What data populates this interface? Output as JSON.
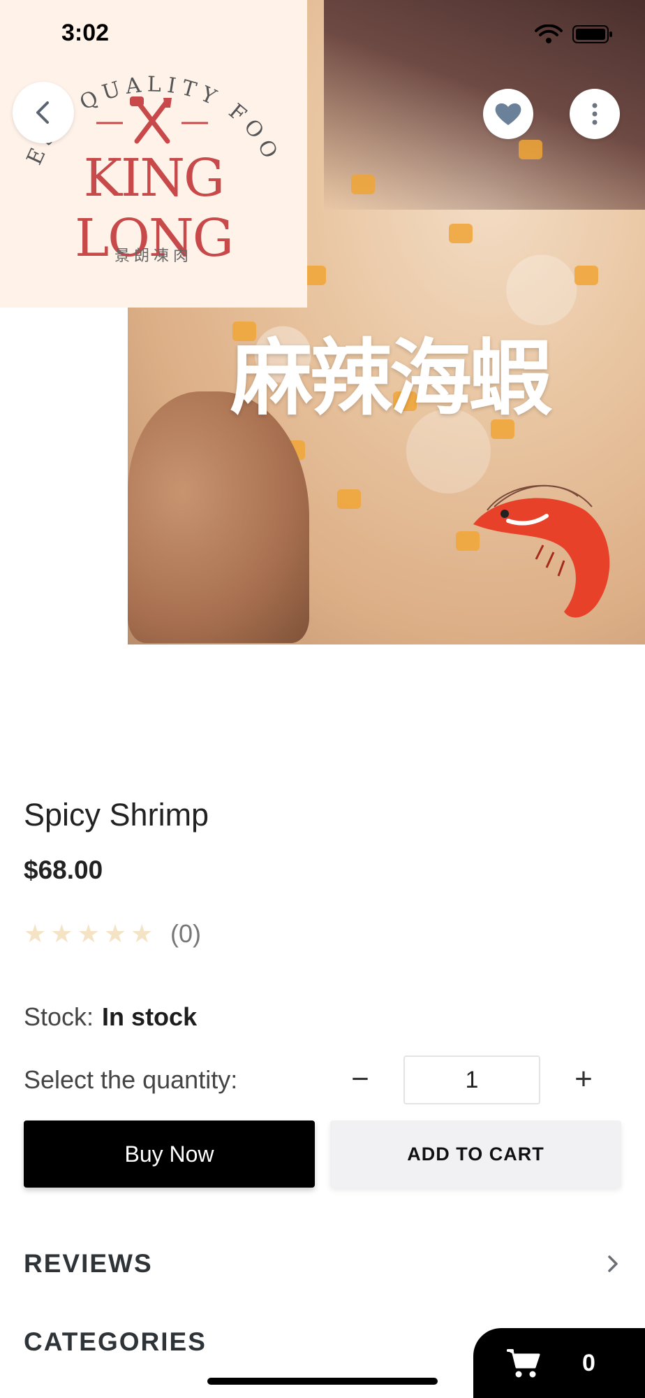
{
  "status_bar": {
    "time": "3:02"
  },
  "hero": {
    "promo_title": "麻辣海蝦",
    "logo": {
      "arc_text": "BEST QUALITY FOOD",
      "name": "KING LONG",
      "subtitle": "景朗凍肉"
    }
  },
  "top_actions": {
    "back_icon": "chevron-left-icon",
    "favorite_icon": "heart-icon",
    "more_icon": "vertical-dots-icon"
  },
  "product": {
    "title": "Spicy Shrimp",
    "price": "$68.00",
    "rating": {
      "stars": 0,
      "max": 5,
      "count_label": "(0)"
    },
    "stock_label": "Stock:",
    "stock_value": "In stock",
    "quantity_label": "Select the quantity:",
    "quantity_value": "1",
    "minus_symbol": "−",
    "plus_symbol": "+"
  },
  "actions": {
    "buy_now": "Buy Now",
    "add_to_cart": "ADD TO CART"
  },
  "sections": {
    "reviews": "REVIEWS",
    "categories": "CATEGORIES"
  },
  "cart": {
    "count": "0"
  },
  "colors": {
    "logo_red": "#c8494a",
    "logo_bg": "#fff2e9",
    "star_empty": "#f5e3c6",
    "primary_button": "#000000",
    "secondary_button": "#f1f1f3"
  }
}
